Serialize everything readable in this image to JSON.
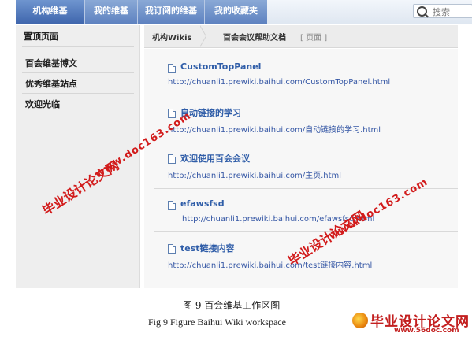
{
  "nav": {
    "tabs": [
      {
        "label": "机构维基",
        "active": true
      },
      {
        "label": "我的维基",
        "active": false
      },
      {
        "label": "我订阅的维基",
        "active": false
      },
      {
        "label": "我的收藏夹",
        "active": false
      }
    ],
    "search_placeholder": "搜索"
  },
  "sidebar": {
    "title": "置顶页面",
    "items": [
      "百会维基博文",
      "优秀维基站点",
      "欢迎光临"
    ]
  },
  "breadcrumb": {
    "root": "机构Wikis",
    "page": "百会会议帮助文档",
    "type": "[ 页面 ]"
  },
  "pages": [
    {
      "title": "CustomTopPanel",
      "url": "http://chuanli1.prewiki.baihui.com/CustomTopPanel.html"
    },
    {
      "title": "自动链接的学习",
      "url": "http://chuanli1.prewiki.baihui.com/自动链接的学习.html"
    },
    {
      "title": "欢迎使用百会会议",
      "url": "http://chuanli1.prewiki.baihui.com/主页.html"
    },
    {
      "title": "efawsfsd",
      "url": "http://chuanli1.prewiki.baihui.com/efawsfsd.html"
    },
    {
      "title": "test链接内容",
      "url": "http://chuanli1.prewiki.baihui.com/test链接内容.html"
    }
  ],
  "watermark": {
    "cn": "毕业设计论文网",
    "url": "www.doc163.com",
    "color": "#d21b1b"
  },
  "caption": {
    "cn": "图 9  百会维基工作区图",
    "en": "Fig 9    Figure Baihui Wiki workspace"
  },
  "logo": {
    "name": "毕业设计论文网",
    "url": "www.56doc.com"
  }
}
